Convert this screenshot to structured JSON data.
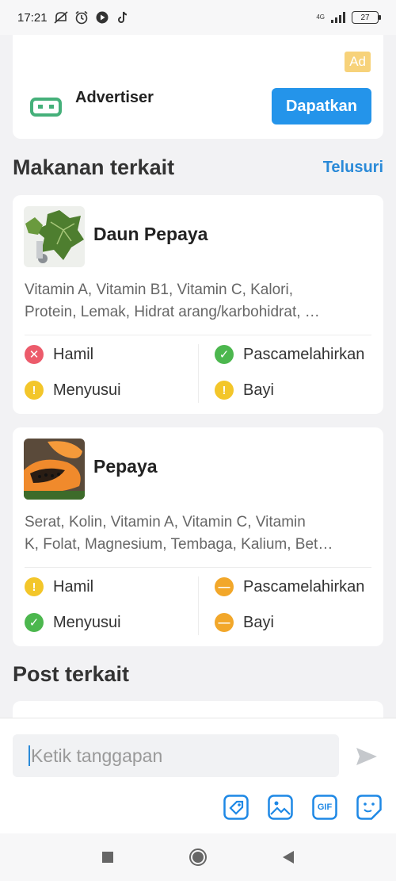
{
  "status_bar": {
    "time": "17:21",
    "battery": "27",
    "network": "4G"
  },
  "ad": {
    "badge": "Ad",
    "advertiser": "Advertiser",
    "cta": "Dapatkan"
  },
  "related_foods": {
    "title": "Makanan terkait",
    "link": "Telusuri",
    "items": [
      {
        "name": "Daun Pepaya",
        "description": "Vitamin A, Vitamin B1, Vitamin C, Kalori,\nProtein, Lemak, Hidrat arang/karbohidrat, …",
        "statuses": [
          {
            "label": "Hamil",
            "level": "no"
          },
          {
            "label": "Pascamelahirkan",
            "level": "yes"
          },
          {
            "label": "Menyusui",
            "level": "caution"
          },
          {
            "label": "Bayi",
            "level": "caution"
          }
        ]
      },
      {
        "name": "Pepaya",
        "description": "Serat, Kolin, Vitamin A, Vitamin C, Vitamin\nK, Folat, Magnesium, Tembaga, Kalium, Bet…",
        "statuses": [
          {
            "label": "Hamil",
            "level": "caution"
          },
          {
            "label": "Pascamelahirkan",
            "level": "limited"
          },
          {
            "label": "Menyusui",
            "level": "yes"
          },
          {
            "label": "Bayi",
            "level": "limited"
          }
        ]
      }
    ]
  },
  "related_posts": {
    "title": "Post terkait"
  },
  "comment": {
    "placeholder": "Ketik tanggapan",
    "gif_label": "GIF"
  },
  "colors": {
    "accent": "#2494ea",
    "no": "#ec5b6b",
    "yes": "#4cb74e",
    "caution": "#f3c62a",
    "limited": "#f2a72a"
  }
}
